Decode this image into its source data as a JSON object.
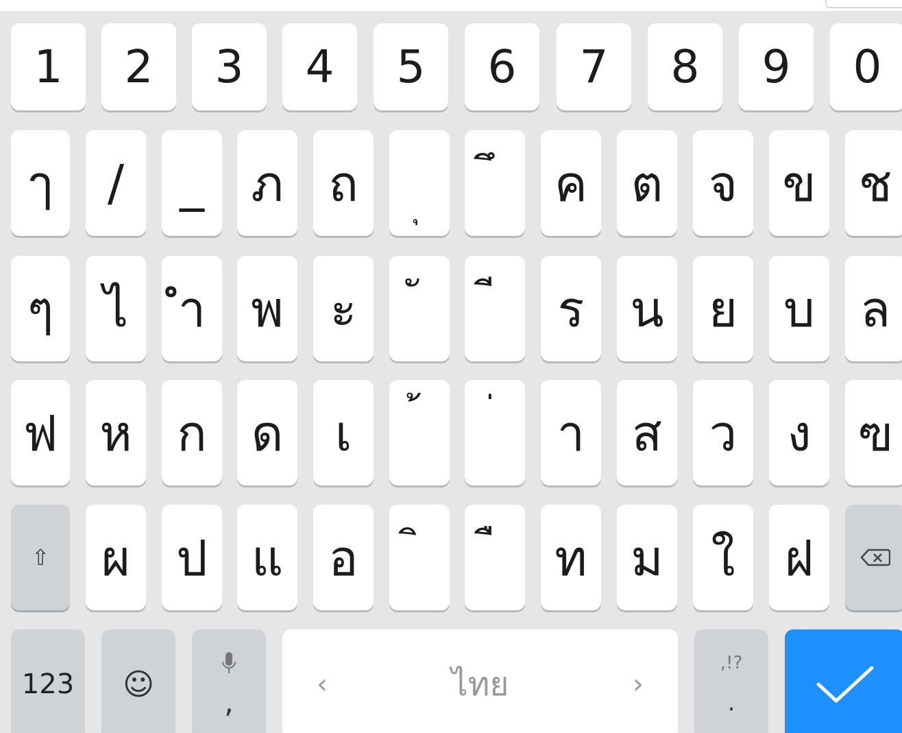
{
  "keyboard": {
    "row_numbers": [
      "1",
      "2",
      "3",
      "4",
      "5",
      "6",
      "7",
      "8",
      "9",
      "0"
    ],
    "row2": [
      "ๅ",
      "/",
      "_",
      "ภ",
      "ถ",
      "ุ",
      "ึ",
      "ค",
      "ต",
      "จ",
      "ข",
      "ช"
    ],
    "row3": [
      "ๆ",
      "ไ",
      "ำ",
      "พ",
      "ะ",
      "ั",
      "ี",
      "ร",
      "น",
      "ย",
      "บ",
      "ล"
    ],
    "row4": [
      "ฟ",
      "ห",
      "ก",
      "ด",
      "เ",
      "้",
      "่",
      "า",
      "ส",
      "ว",
      "ง",
      "ฃ"
    ],
    "row5": [
      "ผ",
      "ป",
      "แ",
      "อ",
      "ิ",
      "ื",
      "ท",
      "ม",
      "ใ",
      "ฝ"
    ],
    "bottom": {
      "numbers_label": "123",
      "emoji_symbol": "☺",
      "comma_label": ",",
      "space_left_arrow": "‹",
      "space_language": "ไทย",
      "space_right_arrow": "›",
      "punct_top": ",!?",
      "punct_bottom": "."
    },
    "colors": {
      "enter_bg": "#1e90ff",
      "key_bg": "#ffffff",
      "function_key_bg": "#cfd3d8",
      "keyboard_bg": "#e6e6e6"
    }
  }
}
